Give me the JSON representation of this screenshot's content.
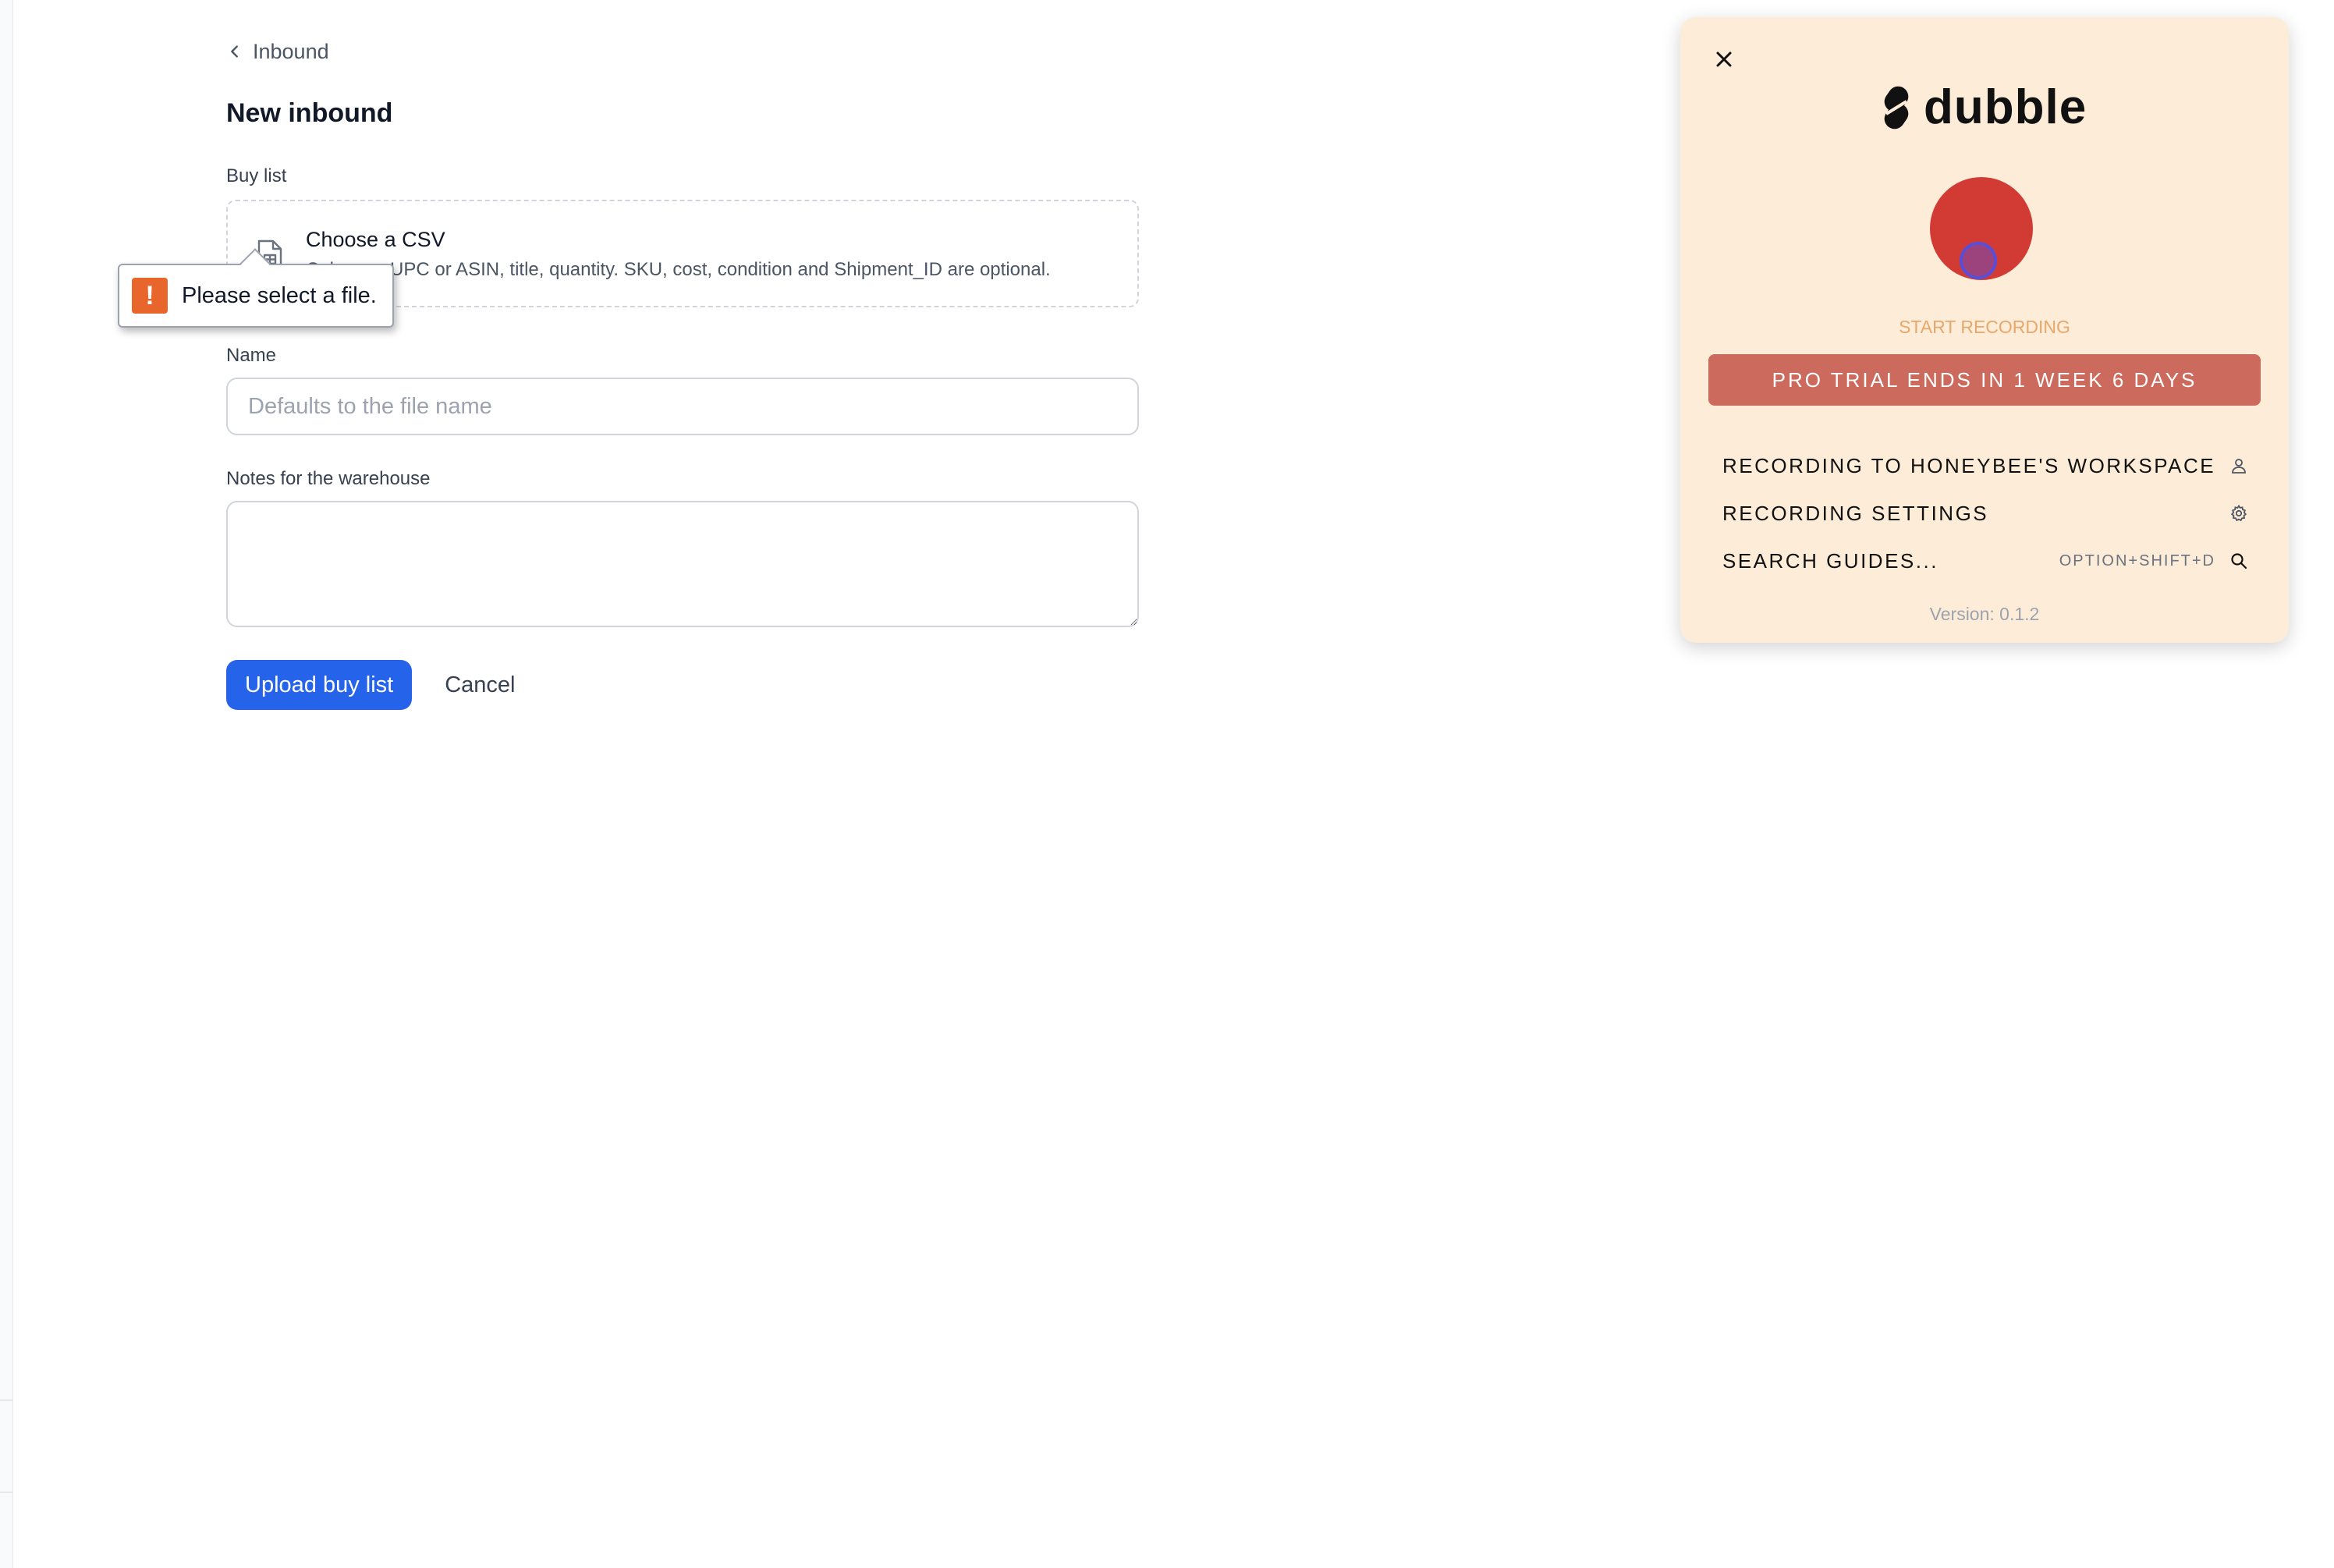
{
  "breadcrumb": {
    "label": "Inbound"
  },
  "page": {
    "title": "New inbound"
  },
  "form": {
    "buy_list_label": "Buy list",
    "dropzone_title": "Choose a CSV",
    "dropzone_subtitle": "Columns: UPC or ASIN, title, quantity. SKU, cost, condition and Shipment_ID are optional.",
    "name_label": "Name",
    "name_placeholder": "Defaults to the file name",
    "name_value": "",
    "notes_label": "Notes for the warehouse",
    "notes_value": "",
    "submit_label": "Upload buy list",
    "cancel_label": "Cancel"
  },
  "validation": {
    "message": "Please select a file.",
    "icon": "warning-icon",
    "color": "#e8662c"
  },
  "dubble": {
    "logo_text": "dubble",
    "start_label": "START RECORDING",
    "trial_banner": "PRO TRIAL ENDS IN 1 WEEK 6 DAYS",
    "menu": [
      {
        "label": "RECORDING TO HONEYBEE'S WORKSPACE",
        "icon": "user-icon",
        "shortcut": ""
      },
      {
        "label": "RECORDING SETTINGS",
        "icon": "gear-icon",
        "shortcut": ""
      },
      {
        "label": "SEARCH GUIDES...",
        "icon": "search-icon",
        "shortcut": "OPTION+SHIFT+D"
      }
    ],
    "version": "Version: 0.1.2",
    "colors": {
      "panel_bg": "#fdecd7",
      "record": "#d13b33",
      "trial": "#cc6a5d",
      "start_label": "#e6a86d"
    }
  },
  "colors": {
    "primary": "#2563eb"
  }
}
